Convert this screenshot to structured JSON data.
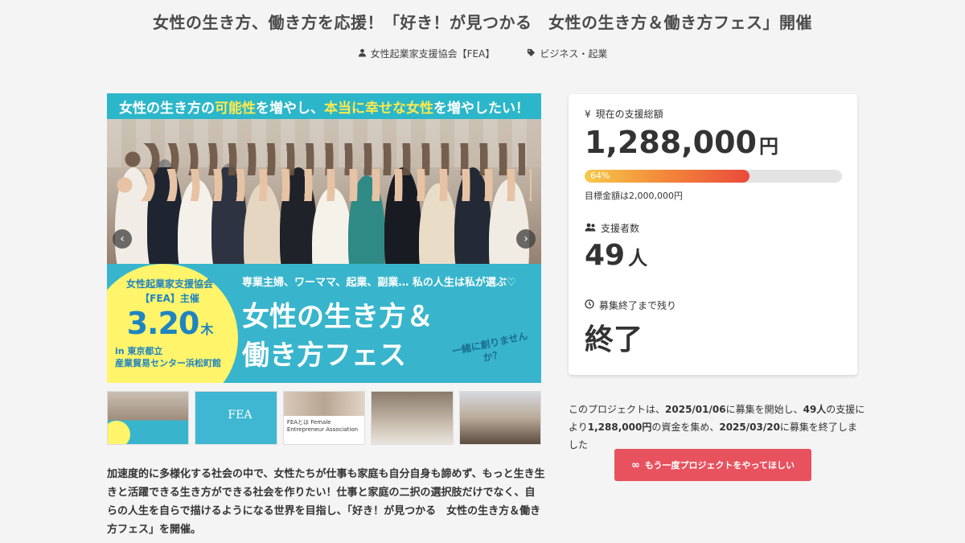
{
  "page": {
    "title": "女性の生き方、働き方を応援！「好き！が見つかる　女性の生き方＆働き方フェス」開催",
    "owner": "女性起業家支援協会【FEA】",
    "category": "ビジネス・起業"
  },
  "hero": {
    "banner_pre": "女性の生き方の",
    "banner_hl1": "可能性",
    "banner_mid": "を増やし、",
    "banner_hl2": "本当に幸せな女性",
    "banner_post": "を増やしたい！",
    "org_line1": "女性起業家支援協会",
    "org_line2": "【FEA】主催",
    "date": "3.20",
    "date_day": "木",
    "venue_line1": "in 東京都立",
    "venue_line2": "産業貿易センター浜松町館",
    "subtitle": "専業主婦、ワーママ、起業、副業… 私の人生は私が選ぶ♡",
    "title_line1": "女性の生き方＆",
    "title_line2": "働き方フェス",
    "callout": "一緒に創りませんか？",
    "prev_arrow": "‹",
    "next_arrow": "›"
  },
  "thumbs": [
    {
      "caption": ""
    },
    {
      "caption": "FEA"
    },
    {
      "caption": "FEAとは Female Entrepreneur Association"
    },
    {
      "caption": ""
    },
    {
      "caption": ""
    }
  ],
  "description": "加速度的に多様化する社会の中で、女性たちが仕事も家庭も自分自身も諦めず、もっと生き生きと活躍できる生き方ができる社会を作りたい！仕事と家庭の二択の選択肢だけでなく、自らの人生を自らで描けるようになる世界を目指し、「好き！が見つかる　女性の生き方＆働き方フェス」を開催。",
  "stats": {
    "total_label": "現在の支援総額",
    "total_value": "1,288,000",
    "total_unit": "円",
    "progress": 64,
    "progress_text": "64%",
    "goal": "目標金額は2,000,000円",
    "supporters_label": "支援者数",
    "supporters_value": "49",
    "supporters_unit": "人",
    "remaining_label": "募集終了まで残り",
    "remaining_value": "終了"
  },
  "summary": {
    "p1": "このプロジェクトは、",
    "start": "2025/01/06",
    "p2": "に募集を開始し、",
    "count": "49人",
    "p3": "の支援により",
    "amount": "1,288,000円",
    "p4": "の資金を集め、",
    "end": "2025/03/20",
    "p5": "に募集を終了しました"
  },
  "cta": {
    "label": "もう一度プロジェクトをやってほしい"
  },
  "icons": {
    "owner": "user-icon",
    "category": "tag-icon",
    "total": "yen-icon",
    "supporters": "users-icon",
    "remaining": "clock-icon",
    "cta": "infinity-icon"
  },
  "colors": {
    "accent": "#e8525f",
    "teal": "#38b5cc",
    "yellow": "#fff46a"
  }
}
